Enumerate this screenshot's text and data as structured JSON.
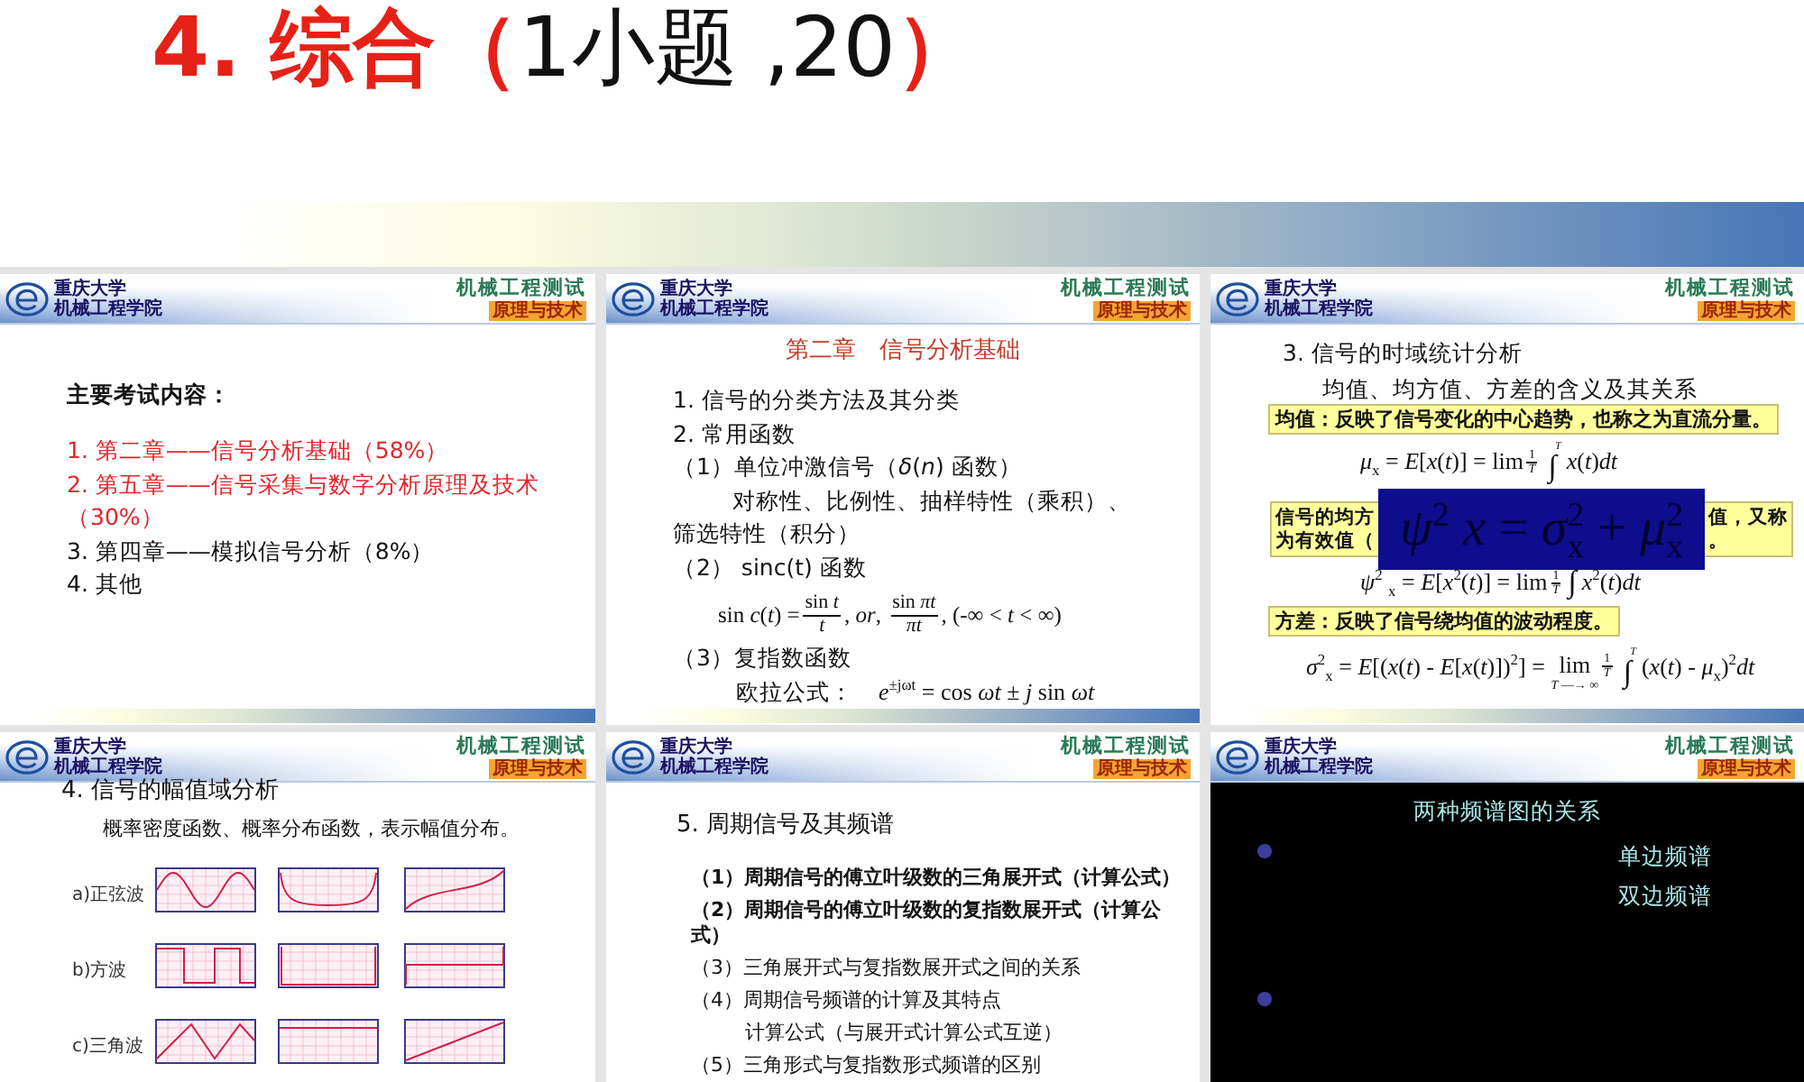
{
  "title": {
    "segments": [
      {
        "text": "4. 综合（",
        "highlight": true
      },
      {
        "text": "1小题 ,20",
        "highlight": false
      },
      {
        "text": "）",
        "highlight": true
      }
    ]
  },
  "slides": [
    {
      "kind": "outline",
      "header": {
        "school": "重庆大学",
        "college": "机械工程学院",
        "course": "机械工程测试",
        "subtitle": "原理与技术"
      },
      "heading": "主要考试内容：",
      "items": [
        {
          "text": "1. 第二章——信号分析基础（58%）",
          "highlight": true
        },
        {
          "text": "2. 第五章——信号采集与数字分析原理及技术（30%）",
          "highlight": true
        },
        {
          "text": "3. 第四章——模拟信号分析（8%）",
          "highlight": false
        },
        {
          "text": "4. 其他",
          "highlight": false
        }
      ]
    },
    {
      "kind": "chapter",
      "header": {
        "school": "重庆大学",
        "college": "机械工程学院",
        "course": "机械工程测试",
        "subtitle": "原理与技术"
      },
      "heading": "第二章　信号分析基础",
      "lines": [
        {
          "kind": "item",
          "text": "1. 信号的分类方法及其分类"
        },
        {
          "kind": "item",
          "text": "2. 常用函数"
        },
        {
          "kind": "item",
          "text": "（1）单位冲激信号（*δ*(*n*) 函数）"
        },
        {
          "kind": "indent",
          "text": "对称性、比例性、抽样特性（乘积）、"
        },
        {
          "kind": "item",
          "text": "筛选特性（积分）"
        },
        {
          "kind": "item",
          "text": "（2） sinc(t) 函数"
        },
        {
          "kind": "formula",
          "parts": [
            {
              "kind": "text",
              "text": "sin *c*(*t*) ="
            },
            {
              "kind": "frac",
              "num": "sin *t*",
              "den": "*t*"
            },
            {
              "kind": "text",
              "text": ", *or*, "
            },
            {
              "kind": "frac",
              "num": "sin *πt*",
              "den": "*πt*"
            },
            {
              "kind": "text",
              "text": ", (-∞ < *t* < ∞)"
            }
          ]
        },
        {
          "kind": "item",
          "text": "（3）复指数函数"
        },
        {
          "kind": "labeled-formula",
          "label": "欧拉公式：",
          "parts": [
            {
              "kind": "text",
              "text": "*e*$^{±jωt}$ = cos *ωt* ± *j* sin *ωt*"
            }
          ]
        }
      ]
    },
    {
      "kind": "statistics",
      "header": {
        "school": "重庆大学",
        "college": "机械工程学院",
        "course": "机械工程测试",
        "subtitle": "原理与技术"
      },
      "lines": [
        {
          "kind": "item",
          "text": "3. 信号的时域统计分析"
        },
        {
          "kind": "indent",
          "text": "均值、均方值、方差的含义及其关系"
        },
        {
          "kind": "callout",
          "text": "均值：反映了信号变化的中心趋势，也称之为直流分量。"
        },
        {
          "kind": "formula",
          "parts": [
            {
              "kind": "text",
              "text": "*μ*$_{x}$ = *E*[*x*(*t*)] = lim"
            },
            {
              "kind": "frac",
              "num": "1",
              "den": "*T*"
            },
            {
              "kind": "integral",
              "sign": "∫",
              "upper": "*T*"
            },
            {
              "kind": "text",
              "text": "*x*(*t*)*dt*"
            }
          ]
        },
        {
          "kind": "covered-callout",
          "left": [
            "信号的均方",
            "为有效值（"
          ],
          "overlay": "*ψ*$^{2}$ *x* = *σ*$^{2}$$_{x}$ + *μ*$^{2}$$_{x}$",
          "right": [
            "值，又称",
            "。"
          ]
        },
        {
          "kind": "formula",
          "parts": [
            {
              "kind": "text",
              "text": "*ψ*$^{2}$ $_{x}$ = *E*[*x*$^{2}$(*t*)] = lim"
            },
            {
              "kind": "frac",
              "num": "1",
              "den": "*T*"
            },
            {
              "kind": "integral",
              "sign": "∫"
            },
            {
              "kind": "text",
              "text": "*x*$^{2}$(*t*)*dt*"
            }
          ]
        },
        {
          "kind": "callout",
          "text": "方差：反映了信号绕均值的波动程度。"
        },
        {
          "kind": "formula",
          "parts": [
            {
              "kind": "text",
              "text": "*σ*$^{2}$$_{x}$ = *E*[(*x*(*t*) - *E*[*x*(*t*)])$^{2}$] = "
            },
            {
              "kind": "limit",
              "text": "lim",
              "below": "*T* —→ ∞"
            },
            {
              "kind": "frac",
              "num": "1",
              "den": "*T*"
            },
            {
              "kind": "integral",
              "sign": "∫",
              "upper": "*T*"
            },
            {
              "kind": "text",
              "text": "(*x*(*t*) - *μ*$_{x}$)$^{2}$*dt*"
            }
          ]
        }
      ]
    },
    {
      "kind": "amplitude",
      "header": {
        "school": "重庆大学",
        "college": "机械工程学院",
        "course": "机械工程测试",
        "subtitle": "原理与技术"
      },
      "heading": "4. 信号的幅值域分析",
      "subheading": "概率密度函数、概率分布函数，表示幅值分布。",
      "plots": [
        {
          "label": "a)正弦波",
          "kind": "sine"
        },
        {
          "label": "b)方波",
          "kind": "square"
        },
        {
          "label": "c)三角波",
          "kind": "triangle"
        }
      ]
    },
    {
      "kind": "spectrum",
      "header": {
        "school": "重庆大学",
        "college": "机械工程学院",
        "course": "机械工程测试",
        "subtitle": "原理与技术"
      },
      "heading": "5. 周期信号及其频谱",
      "items": [
        {
          "kind": "item",
          "text": "（1）周期信号的傅立叶级数的三角展开式（计算公式）",
          "bold": true
        },
        {
          "kind": "item",
          "text": "（2）周期信号的傅立叶级数的复指数展开式（计算公式）",
          "bold": true
        },
        {
          "kind": "item",
          "text": "（3）三角展开式与复指数展开式之间的关系",
          "bold": false
        },
        {
          "kind": "item",
          "text": "（4）周期信号频谱的计算及其特点",
          "bold": false
        },
        {
          "kind": "indent",
          "text": "计算公式（与展开式计算公式互逆）",
          "bold": false
        },
        {
          "kind": "item",
          "text": "（5）三角形式与复指数形式频谱的区别",
          "bold": false
        }
      ]
    },
    {
      "kind": "dark",
      "header": {
        "school": "重庆大学",
        "college": "机械工程学院",
        "course": "机械工程测试",
        "subtitle": "原理与技术"
      },
      "heading": "两种频谱图的关系",
      "bullets": [
        {
          "kind": "dot",
          "labels": [
            "单边频谱",
            "双边频谱"
          ]
        },
        {
          "kind": "dot"
        }
      ]
    }
  ]
}
